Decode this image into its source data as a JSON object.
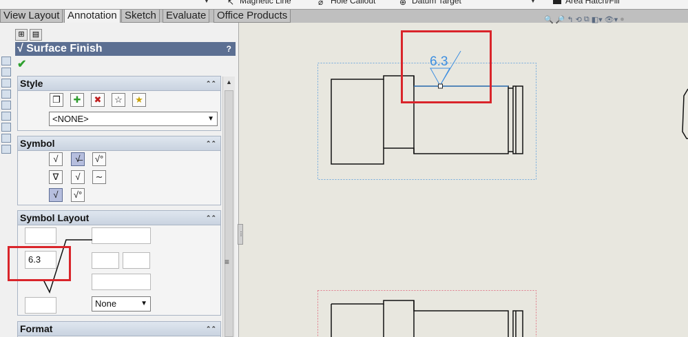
{
  "top_commands": [
    {
      "label": "Magnetic Line",
      "icon": "magnetic-line-icon"
    },
    {
      "label": "Hole Callout",
      "icon": "hole-callout-icon"
    },
    {
      "label": "Datum Target",
      "icon": "datum-target-icon"
    },
    {
      "label": "Area Hatch/Fill",
      "icon": "area-hatch-icon"
    }
  ],
  "tabs": [
    "View Layout",
    "Annotation",
    "Sketch",
    "Evaluate",
    "Office Products"
  ],
  "active_tab": "Annotation",
  "property_manager": {
    "title": "Surface Finish",
    "help": "?",
    "ok_icon": "checkmark-icon",
    "style": {
      "heading": "Style",
      "select_value": "<NONE>"
    },
    "symbol": {
      "heading": "Symbol"
    },
    "symbol_layout": {
      "heading": "Symbol Layout",
      "roughness_value": "6.3",
      "lay_direction": "None"
    },
    "format": {
      "heading": "Format"
    }
  },
  "drawing": {
    "callout_value": "6.3"
  },
  "colors": {
    "header_bg": "#5c6f92",
    "highlight_red": "#d9242a",
    "annotation_blue": "#3c8ee0",
    "view_border_blue": "#6fa8dc",
    "view_border_pink": "#e07a8a",
    "graphics_bg": "#e8e7df"
  }
}
